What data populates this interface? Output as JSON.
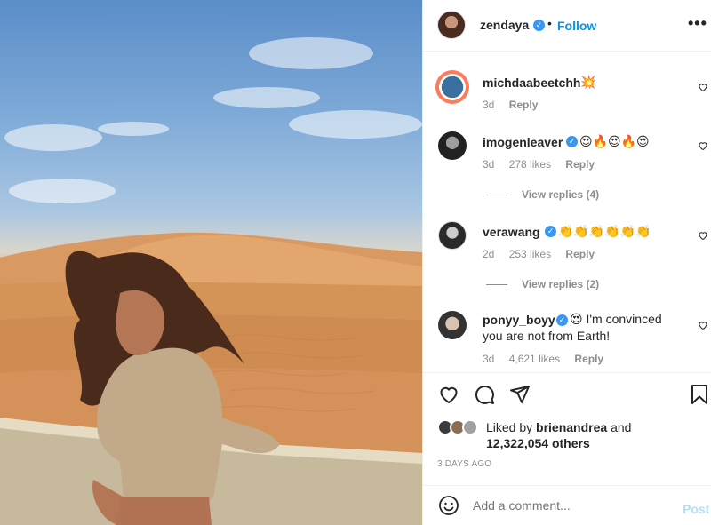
{
  "post": {
    "username": "zendaya",
    "separator": "•",
    "follow_label": "Follow",
    "more_label": "•••",
    "photo_icon": "desert-portrait-photo"
  },
  "comments": [
    {
      "username": "michdaabeetchh",
      "text": "💥",
      "time": "3d",
      "likes": "",
      "reply": "Reply",
      "verified": false,
      "view_replies": ""
    },
    {
      "username": "imogenleaver",
      "text": "😍🔥😍🔥😍",
      "time": "3d",
      "likes": "278 likes",
      "reply": "Reply",
      "verified": true,
      "view_replies": "View replies (4)"
    },
    {
      "username": "verawang",
      "text": "👏👏👏👏👏👏",
      "time": "2d",
      "likes": "253 likes",
      "reply": "Reply",
      "verified": true,
      "view_replies": "View replies (2)"
    },
    {
      "username": "ponyy_boyy",
      "text": "😍 I'm convinced you are not from Earth!",
      "text_line1": "😍 I'm convinced",
      "text_line2": "you are not from Earth!",
      "time": "3d",
      "likes": "4,621 likes",
      "reply": "Reply",
      "verified": true,
      "view_replies": ""
    }
  ],
  "actions": {
    "like_icon": "heart-icon",
    "comment_icon": "comment-icon",
    "share_icon": "share-icon",
    "save_icon": "bookmark-icon"
  },
  "likes": {
    "prefix": "Liked by",
    "user": "brienandrea",
    "and": "and",
    "others": "12,322,054 others"
  },
  "timestamp": "3 DAYS AGO",
  "add_comment": {
    "placeholder": "Add a comment...",
    "post_label": "Post",
    "emoji_icon": "smiley-icon"
  },
  "colors": {
    "link": "#0095f6",
    "verified": "#3897f0",
    "muted": "#8e8e8e"
  }
}
